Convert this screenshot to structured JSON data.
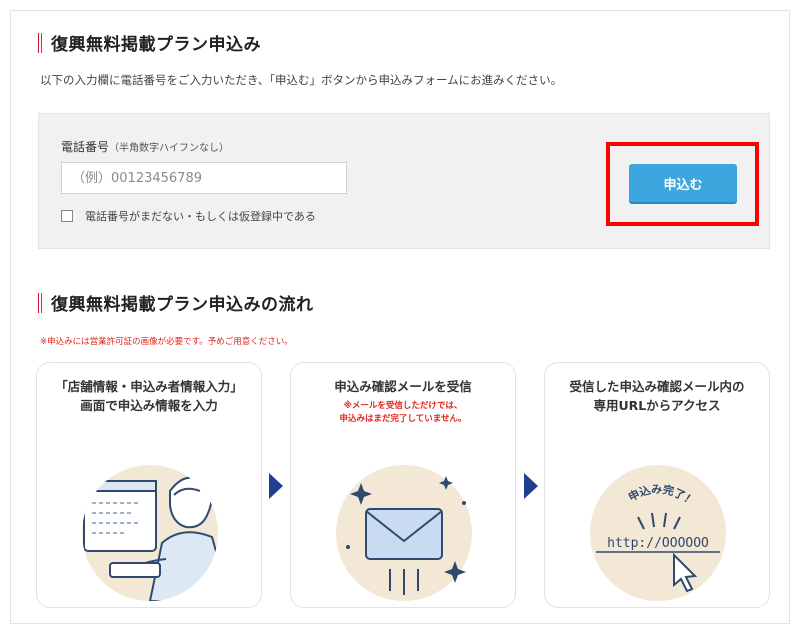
{
  "section1": {
    "title": "復興無料掲載プラン申込み",
    "intro": "以下の入力欄に電話番号をご入力いただき、「申込む」ボタンから申込みフォームにお進みください。"
  },
  "form": {
    "phone_label": "電話番号",
    "phone_note": "（半角数字ハイフンなし）",
    "phone_value": "",
    "phone_placeholder": "（例）00123456789",
    "checkbox_label": "電話番号がまだない・もしくは仮登録中である",
    "checkbox_checked": false,
    "apply_button": "申込む",
    "highlight_color": "#ff0000"
  },
  "section2": {
    "title": "復興無料掲載プラン申込みの流れ",
    "warning": "※申込みには営業許可証の画像が必要です。予めご用意ください。"
  },
  "steps": [
    {
      "title_line1": "「店舗情報・申込み者情報入力」",
      "title_line2": "画面で申込み情報を入力",
      "icon": "person-at-computer-icon"
    },
    {
      "title": "申込み確認メールを受信",
      "note_line1": "※メールを受信しただけでは、",
      "note_line2": "申込みはまだ完了していません。",
      "icon": "envelope-icon"
    },
    {
      "title_line1": "受信した申込み確認メール内の",
      "title_line2": "専用URLからアクセス",
      "art_label": "申込み完了！",
      "art_url": "http://OOOOOO",
      "icon": "cursor-click-url-icon"
    }
  ],
  "colors": {
    "accent_red": "#c8102e",
    "button_blue": "#3ea6df",
    "arrow_navy": "#1f3f8f",
    "card_circle": "#f3e7d6"
  }
}
